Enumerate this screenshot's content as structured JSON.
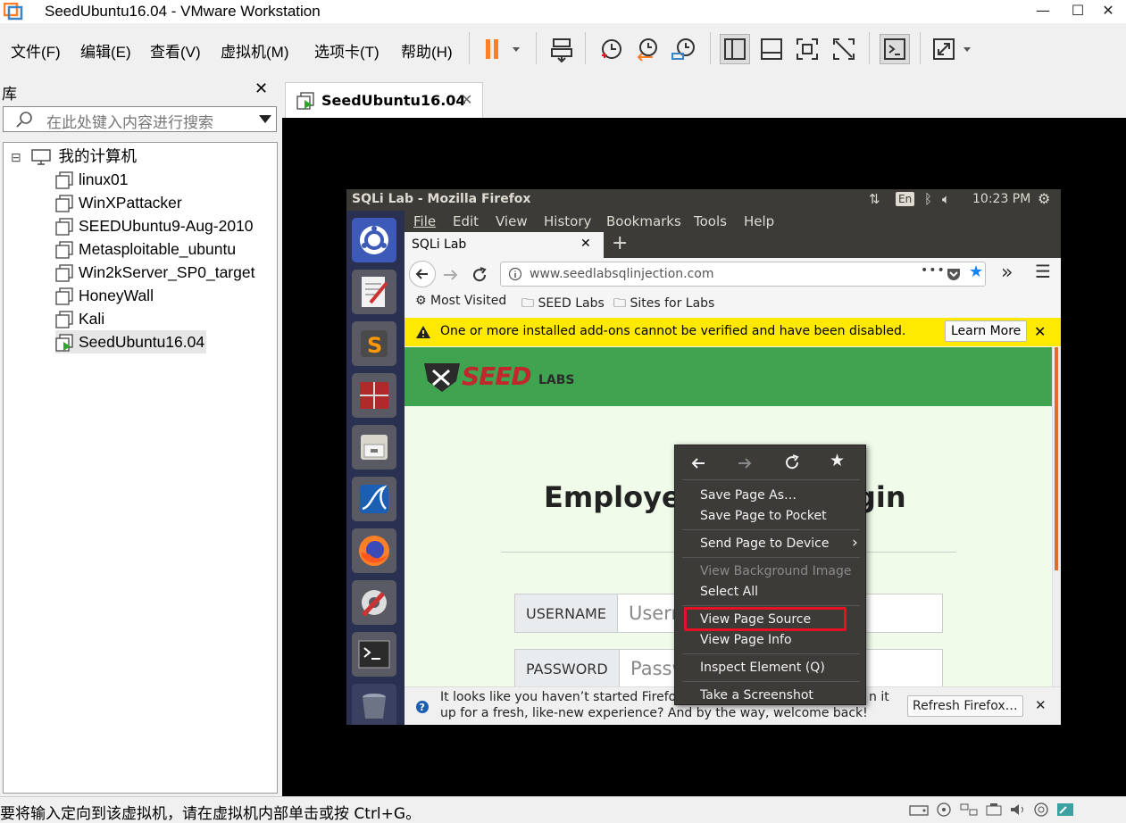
{
  "window": {
    "title": "SeedUbuntu16.04 - VMware Workstation",
    "minimize": "—",
    "maximize": "☐",
    "close": "✕"
  },
  "menubar": {
    "items": [
      "文件(F)",
      "编辑(E)",
      "查看(V)",
      "虚拟机(M)",
      "选项卡(T)",
      "帮助(H)"
    ]
  },
  "toolbar": {
    "icons": [
      "pause-icon",
      "send-ctrl-alt-del-icon",
      "snapshot-icon",
      "revert-snapshot-icon",
      "snapshot-manager-icon",
      "library-view-icon",
      "thumbnail-view-icon",
      "fullscreen-icon",
      "unity-icon",
      "console-icon",
      "stretch-icon"
    ]
  },
  "library": {
    "title": "库",
    "close": "✕",
    "search_placeholder": "在此处键入内容进行搜索",
    "root": "我的计算机",
    "collapse": "⊟",
    "vms": [
      "linux01",
      "WinXPattacker",
      "SEEDUbuntu9-Aug-2010",
      "Metasploitable_ubuntu",
      "Win2kServer_SP0_target",
      "HoneyWall",
      "Kali",
      "SeedUbuntu16.04"
    ],
    "selected_vm": "SeedUbuntu16.04"
  },
  "tab": {
    "label": "SeedUbuntu16.04",
    "close": "✕"
  },
  "statusbar": {
    "text": "要将输入定向到该虚拟机，请在虚拟机内部单击或按 Ctrl+G。"
  },
  "ubuntu": {
    "topbar_title": "SQLi Lab - Mozilla Firefox",
    "keyboard": "En",
    "time": "10:23 PM",
    "firefox": {
      "menu": [
        "File",
        "Edit",
        "View",
        "History",
        "Bookmarks",
        "Tools",
        "Help"
      ],
      "tab_title": "SQLi Lab",
      "tab_close": "✕",
      "new_tab": "+",
      "url": "www.seedlabsqlinjection.com",
      "bookmarks": [
        "Most Visited",
        "SEED Labs",
        "Sites for Labs"
      ],
      "addon_warning": "One or more installed add-ons cannot be verified and have been disabled.",
      "learn_more": "Learn More",
      "page": {
        "logo_main": "SEED",
        "logo_sub": "LABS",
        "heading_left": "Employe",
        "heading_right": "gin",
        "username_label": "USERNAME",
        "username_placeholder": "Usern",
        "password_label": "PASSWORD",
        "password_placeholder": "Passw"
      },
      "refresh_text_line1": "It looks like you haven’t started Firefox",
      "refresh_text_line1_end": "n it",
      "refresh_text_line2": "up for a fresh, like-new experience? And by the way, welcome back!",
      "refresh_button": "Refresh Firefox…"
    },
    "context_menu": {
      "items": [
        {
          "label": "Save Page As…",
          "enabled": true
        },
        {
          "label": "Save Page to Pocket",
          "enabled": true
        },
        {
          "label": "Send Page to Device",
          "enabled": true,
          "submenu": true
        },
        {
          "label": "View Background Image",
          "enabled": false
        },
        {
          "label": "Select All",
          "enabled": true
        },
        {
          "label": "View Page Source",
          "enabled": true,
          "highlighted": true
        },
        {
          "label": "View Page Info",
          "enabled": true
        },
        {
          "label": "Inspect Element (Q)",
          "enabled": true
        },
        {
          "label": "Take a Screenshot",
          "enabled": true
        }
      ],
      "submenu_arrow": "›"
    }
  },
  "colors": {
    "highlight": "#e81123",
    "accent_orange": "#ff7f27",
    "seed_green": "#3fa34f",
    "addon_yellow": "#ffe900",
    "launcher": "#2a3050"
  }
}
